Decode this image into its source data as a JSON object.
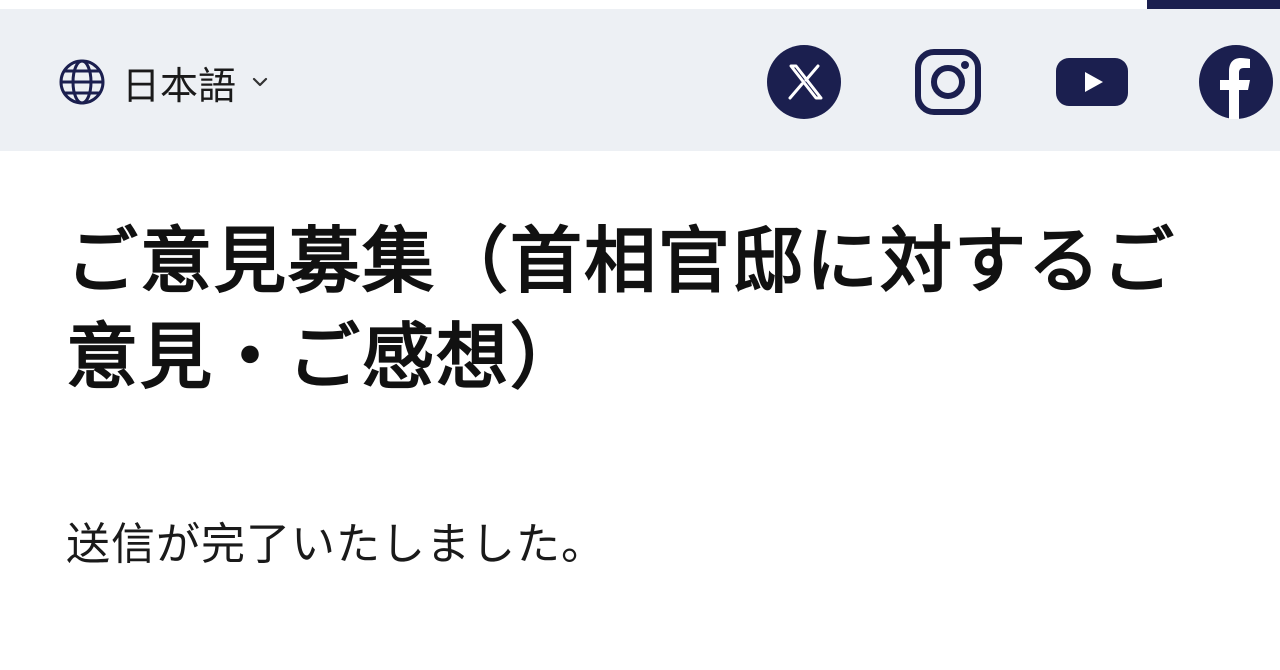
{
  "header": {
    "language": {
      "label": "日本語",
      "icon": "globe-icon",
      "dropdown_icon": "chevron-down-icon"
    },
    "social_links": [
      {
        "name": "x",
        "icon": "x-icon"
      },
      {
        "name": "instagram",
        "icon": "instagram-icon"
      },
      {
        "name": "youtube",
        "icon": "youtube-icon"
      },
      {
        "name": "facebook",
        "icon": "facebook-icon"
      }
    ]
  },
  "main": {
    "title": "ご意見募集（首相官邸に対するご意見・ご感想）",
    "message": "送信が完了いたしました。"
  },
  "colors": {
    "accent": "#1b1f4f",
    "header_background": "#edf0f4",
    "text": "#1a1a1a"
  }
}
